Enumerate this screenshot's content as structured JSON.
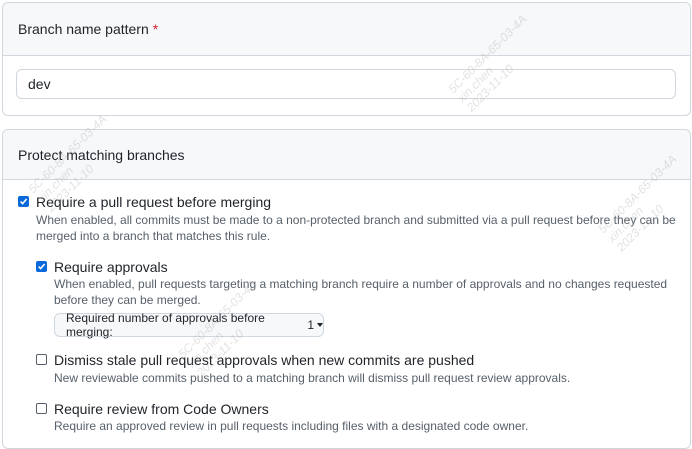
{
  "pattern_section": {
    "title": "Branch name pattern",
    "required_mark": "*",
    "input_value": "dev"
  },
  "protect_section": {
    "title": "Protect matching branches",
    "options": [
      {
        "label": "Require a pull request before merging",
        "checked": true,
        "description": "When enabled, all commits must be made to a non-protected branch and submitted via a pull request before they can be merged into a branch that matches this rule."
      },
      {
        "label": "Require approvals",
        "checked": true,
        "description": "When enabled, pull requests targeting a matching branch require a number of approvals and no changes requested before they can be merged."
      },
      {
        "label": "Dismiss stale pull request approvals when new commits are pushed",
        "checked": false,
        "description": "New reviewable commits pushed to a matching branch will dismiss pull request review approvals."
      },
      {
        "label": "Require review from Code Owners",
        "checked": false,
        "description": "Require an approved review in pull requests including files with a designated code owner."
      }
    ],
    "approvals_select": {
      "label": "Required number of approvals before merging:",
      "value": "1"
    }
  },
  "watermark": {
    "lines": [
      "5C-60-8A-65-03-4A",
      "xin.chen",
      "2023-11-10"
    ]
  },
  "colors": {
    "accent": "#0969da",
    "required": "#cf222e",
    "header_bg": "#f6f8fa",
    "border": "#d0d7de",
    "muted_text": "#57606a"
  }
}
